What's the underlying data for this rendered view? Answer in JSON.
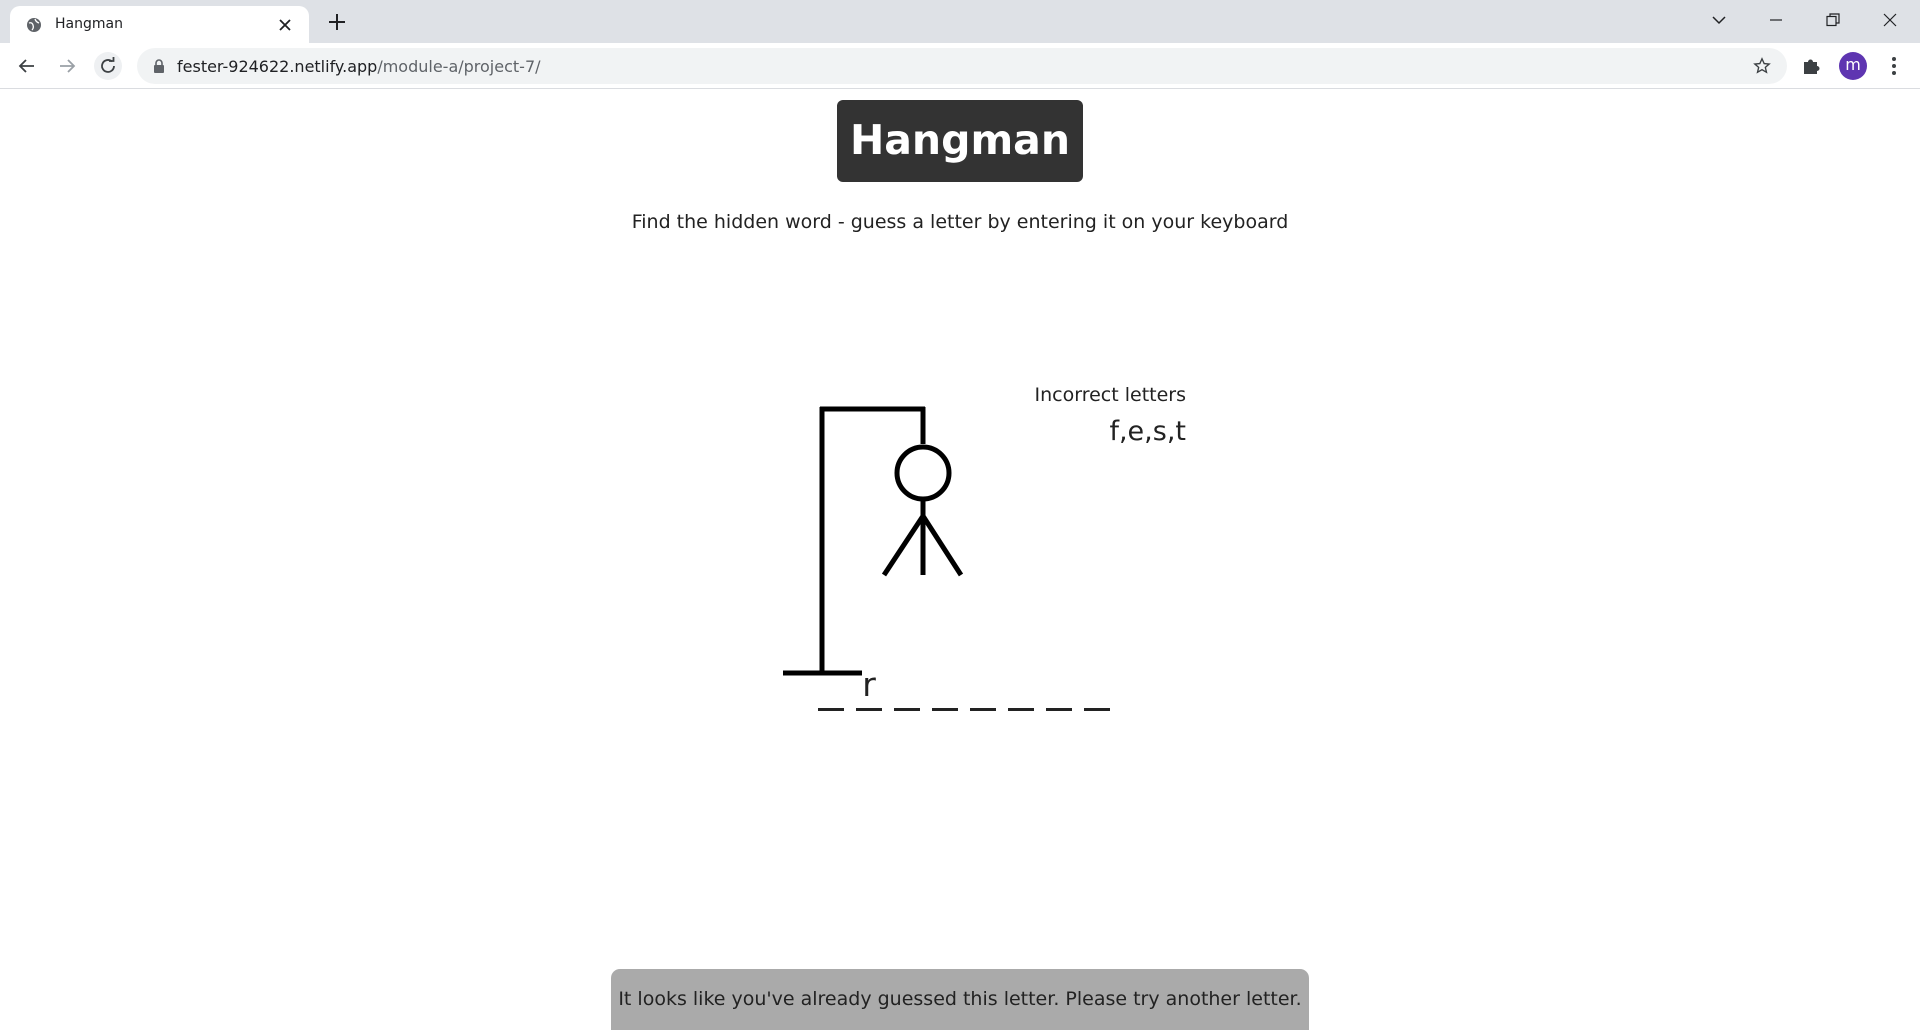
{
  "browser": {
    "tab_title": "Hangman",
    "url_host": "fester-924622.netlify.app",
    "url_path": "/module-a/project-7/",
    "avatar_letter": "m"
  },
  "game": {
    "title": "Hangman",
    "instructions": "Find the hidden word - guess a letter by entering it on your keyboard",
    "incorrect_label": "Incorrect letters",
    "incorrect_letters": "f,e,s,t",
    "word_slots": [
      "",
      "r",
      "",
      "",
      "",
      "",
      "",
      ""
    ],
    "notification": "It looks like you've already guessed this letter. Please try another letter."
  },
  "colors": {
    "title_bg": "#333333",
    "notification_bg": "#aaaaaa",
    "avatar_bg": "#5e35b1"
  }
}
